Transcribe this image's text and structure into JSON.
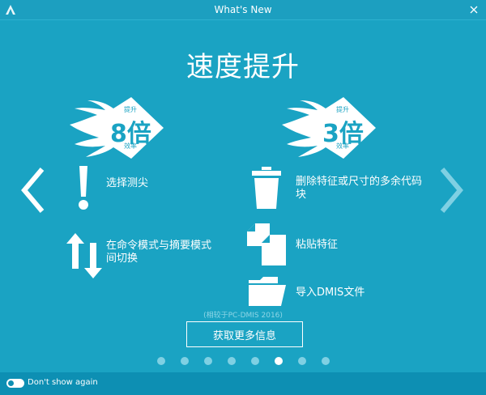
{
  "window": {
    "title": "What's New"
  },
  "heading": "速度提升",
  "badges": [
    {
      "number": "8倍",
      "top": "提升",
      "bottom": "效率"
    },
    {
      "number": "3倍",
      "top": "提升",
      "bottom": "效率"
    }
  ],
  "features": {
    "left": [
      {
        "label": "选择测尖",
        "icon": "probe-icon"
      },
      {
        "label": "在命令模式与摘要模式间切换",
        "icon": "swap-arrows-icon"
      }
    ],
    "right": [
      {
        "label": "删除特征或尺寸的多余代码块",
        "icon": "trash-icon"
      },
      {
        "label": "粘贴特征",
        "icon": "paste-icon"
      },
      {
        "label": "导入DMIS文件",
        "icon": "folder-icon"
      }
    ]
  },
  "footnote": "(相较于PC-DMIS 2016)",
  "more_button": "获取更多信息",
  "pager": {
    "count": 8,
    "active": 6
  },
  "footer": {
    "dont_show_label": "Don't show again"
  },
  "colors": {
    "background": "#1aa3c3",
    "footer": "#0d8fb3",
    "text": "#ffffff"
  }
}
